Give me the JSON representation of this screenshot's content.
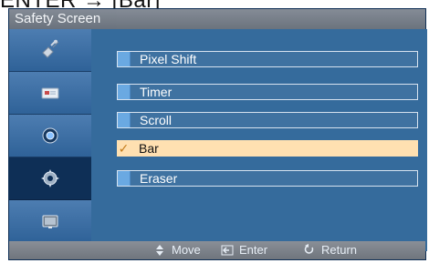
{
  "header": {
    "caption": "ENTER → [Bar]"
  },
  "osd": {
    "title": "Safety Screen",
    "sidebar": {
      "items": [
        {
          "icon": "satellite-icon"
        },
        {
          "icon": "monitor-icon"
        },
        {
          "icon": "disc-icon"
        },
        {
          "icon": "gear-icon",
          "selected": true
        },
        {
          "icon": "display-panel-icon"
        }
      ]
    },
    "menu": {
      "items": [
        {
          "label": "Pixel Shift"
        },
        {
          "label": "Timer"
        },
        {
          "label": "Scroll"
        },
        {
          "label": "Bar",
          "selected": true,
          "check": "✓"
        },
        {
          "label": "Eraser"
        }
      ]
    },
    "footer": {
      "move_label": "Move",
      "enter_label": "Enter",
      "return_label": "Return"
    }
  }
}
